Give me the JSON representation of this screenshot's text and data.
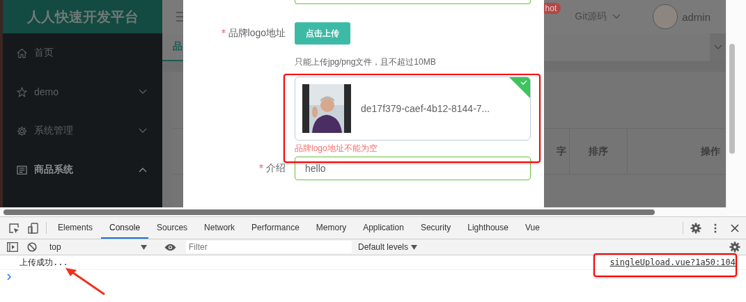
{
  "sidebar": {
    "title": "人人快速开发平台",
    "items": [
      {
        "label": "首页",
        "kind": "link"
      },
      {
        "label": "demo",
        "kind": "submenu",
        "expanded": false
      },
      {
        "label": "系统管理",
        "kind": "submenu",
        "expanded": false
      },
      {
        "label": "商品系统",
        "kind": "submenu",
        "expanded": true
      }
    ]
  },
  "header": {
    "badge": "hot",
    "git_label": "Git源码",
    "user": "admin"
  },
  "tabs": [
    {
      "label": "品",
      "selected": true
    }
  ],
  "table": {
    "columns": [
      "字",
      "排序",
      "操作"
    ]
  },
  "dialog": {
    "upload": {
      "label": "品牌logo地址",
      "required": true,
      "button": "点击上传",
      "tip": "只能上传jpg/png文件，且不超过10MB",
      "file": {
        "name": "de17f379-caef-4b12-8144-7...",
        "uploaded": true
      },
      "error": "品牌logo地址不能为空"
    },
    "intro": {
      "label": "介绍",
      "required": true,
      "value": "hello"
    }
  },
  "devtools": {
    "tabs": [
      {
        "label": "Elements",
        "selected": false
      },
      {
        "label": "Console",
        "selected": true
      },
      {
        "label": "Sources",
        "selected": false
      },
      {
        "label": "Network",
        "selected": false
      },
      {
        "label": "Performance",
        "selected": false
      },
      {
        "label": "Memory",
        "selected": false
      },
      {
        "label": "Application",
        "selected": false
      },
      {
        "label": "Security",
        "selected": false
      },
      {
        "label": "Lighthouse",
        "selected": false
      },
      {
        "label": "Vue",
        "selected": false
      }
    ],
    "context": "top",
    "filter_placeholder": "Filter",
    "levels": "Default levels",
    "messages": [
      {
        "text": "上传成功...",
        "source": "singleUpload.vue?1a50:104"
      }
    ]
  }
}
